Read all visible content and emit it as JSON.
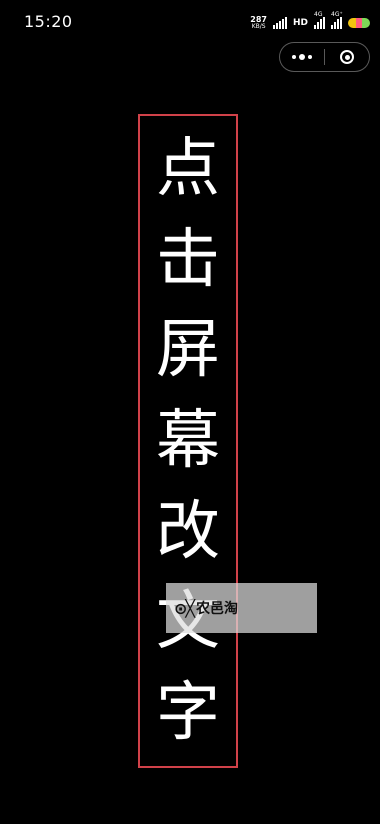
{
  "status_bar": {
    "time": "15:20",
    "net_speed": "287",
    "net_speed_unit": "KB/S",
    "hd_label": "HD",
    "sig1_label": "4G",
    "sig2_label": "4G⁺"
  },
  "capsule": {
    "more_icon": "more-dots-icon",
    "close_icon": "target-close-icon"
  },
  "content": {
    "characters": [
      "点",
      "击",
      "屏",
      "幕",
      "改",
      "文",
      "字"
    ],
    "frame_color": "#d1424a"
  },
  "watermark": {
    "logo": "⊙╳",
    "text": "农邑淘"
  }
}
